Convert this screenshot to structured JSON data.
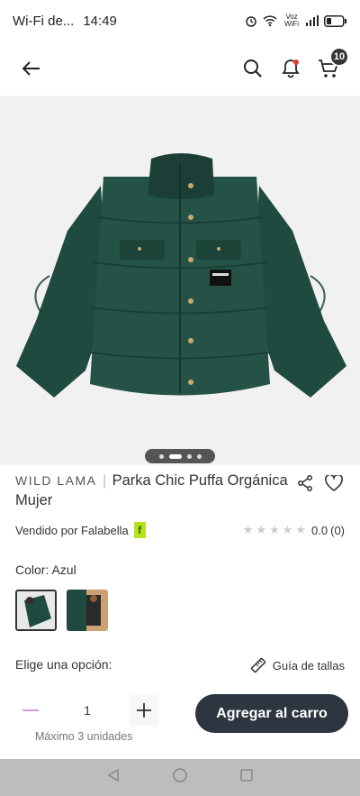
{
  "status_bar": {
    "network": "Wi-Fi de...",
    "time": "14:49",
    "volte": "Voz WiFi"
  },
  "header": {
    "cart_count": "10"
  },
  "product": {
    "brand": "WILD LAMA",
    "separator": "|",
    "title": "Parka Chic Puffa Orgánica Mujer",
    "seller": "Vendido por Falabella",
    "seller_badge": "f",
    "rating_value": "0.0",
    "rating_count": "(0)",
    "stars": 5,
    "color_label": "Color: Azul",
    "option_label": "Elige una opción:",
    "size_guide": "Guía de tallas",
    "quantity": "1",
    "max_units": "Máximo 3 unidades",
    "add_to_cart": "Agregar al carro",
    "image_index": 2,
    "image_total": 4
  },
  "colors": {
    "jacket": "#1f4a40",
    "button": "#2c3540",
    "badge": "#b6e21f"
  }
}
